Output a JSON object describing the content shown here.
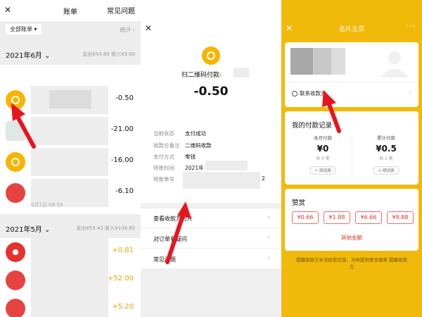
{
  "bill_list": {
    "close_icon": "close-icon",
    "title": "账单",
    "faq": "常见问题",
    "filter_chip": "全部账单",
    "stats": "统计",
    "month1": {
      "label": "2021年6月",
      "summary": "支出¥54.60  收入¥3.00"
    },
    "rows_month1": [
      {
        "amount": "-0.50",
        "icon": "money-bag-icon"
      },
      {
        "amount": "-21.00",
        "icon": "blurred-avatar"
      },
      {
        "amount": "-16.00",
        "icon": "money-bag-icon"
      },
      {
        "amount": "-6.10",
        "icon": "red-envelope-icon",
        "date": "6月1日 08:58"
      }
    ],
    "month2": {
      "label": "2021年5月",
      "summary": "支出¥55.42  收入¥109.80"
    },
    "rows_month2": [
      {
        "amount": "+0.81",
        "icon": "heart-avatar"
      },
      {
        "amount": "+52.00",
        "icon": "red-envelope-icon"
      },
      {
        "amount": "+5.20",
        "icon": "red-envelope-icon"
      }
    ],
    "colors": {
      "coin": "#f7b500",
      "positive": "#f4a000",
      "red": "#e64340"
    }
  },
  "payment_detail": {
    "close_icon": "close-icon",
    "merchant_icon": "money-bag-icon",
    "title": "扫二维码付款-",
    "amount": "-0.50",
    "fields": [
      {
        "key": "当前状态",
        "value": "支付成功"
      },
      {
        "key": "收款方备注",
        "value": "二维码收款"
      },
      {
        "key": "支付方式",
        "value": "零钱"
      },
      {
        "key": "转账时间",
        "value": "2021年"
      },
      {
        "key": "转账单号",
        "value": ""
      }
    ],
    "order_no_tail": "2",
    "actions": [
      {
        "label": "查看收款方名片"
      },
      {
        "label": "对订单有疑问"
      },
      {
        "label": "常见问题"
      }
    ]
  },
  "business_card": {
    "close_icon": "close-icon",
    "title": "名片主页",
    "more": "···",
    "contact": "联系收款方",
    "records": {
      "title": "我的付款记录",
      "this_month": {
        "label": "本月付款",
        "value": "¥0",
        "count": "共 0 笔",
        "button": "晒消费"
      },
      "total": {
        "label": "累计付款",
        "value": "¥0.5",
        "count": "共 1 笔",
        "button": "晒消费"
      }
    },
    "tip": {
      "title": "赞赏",
      "amounts": [
        "¥0.66",
        "¥1.88",
        "¥6.66",
        "¥8.88"
      ],
      "other": "其他金额"
    },
    "footer": "提醒收款方补充经营信息，为你提供更多服务 提醒收款方",
    "colors": {
      "background": "#f1b90a",
      "accent_red": "#e8302c"
    }
  }
}
